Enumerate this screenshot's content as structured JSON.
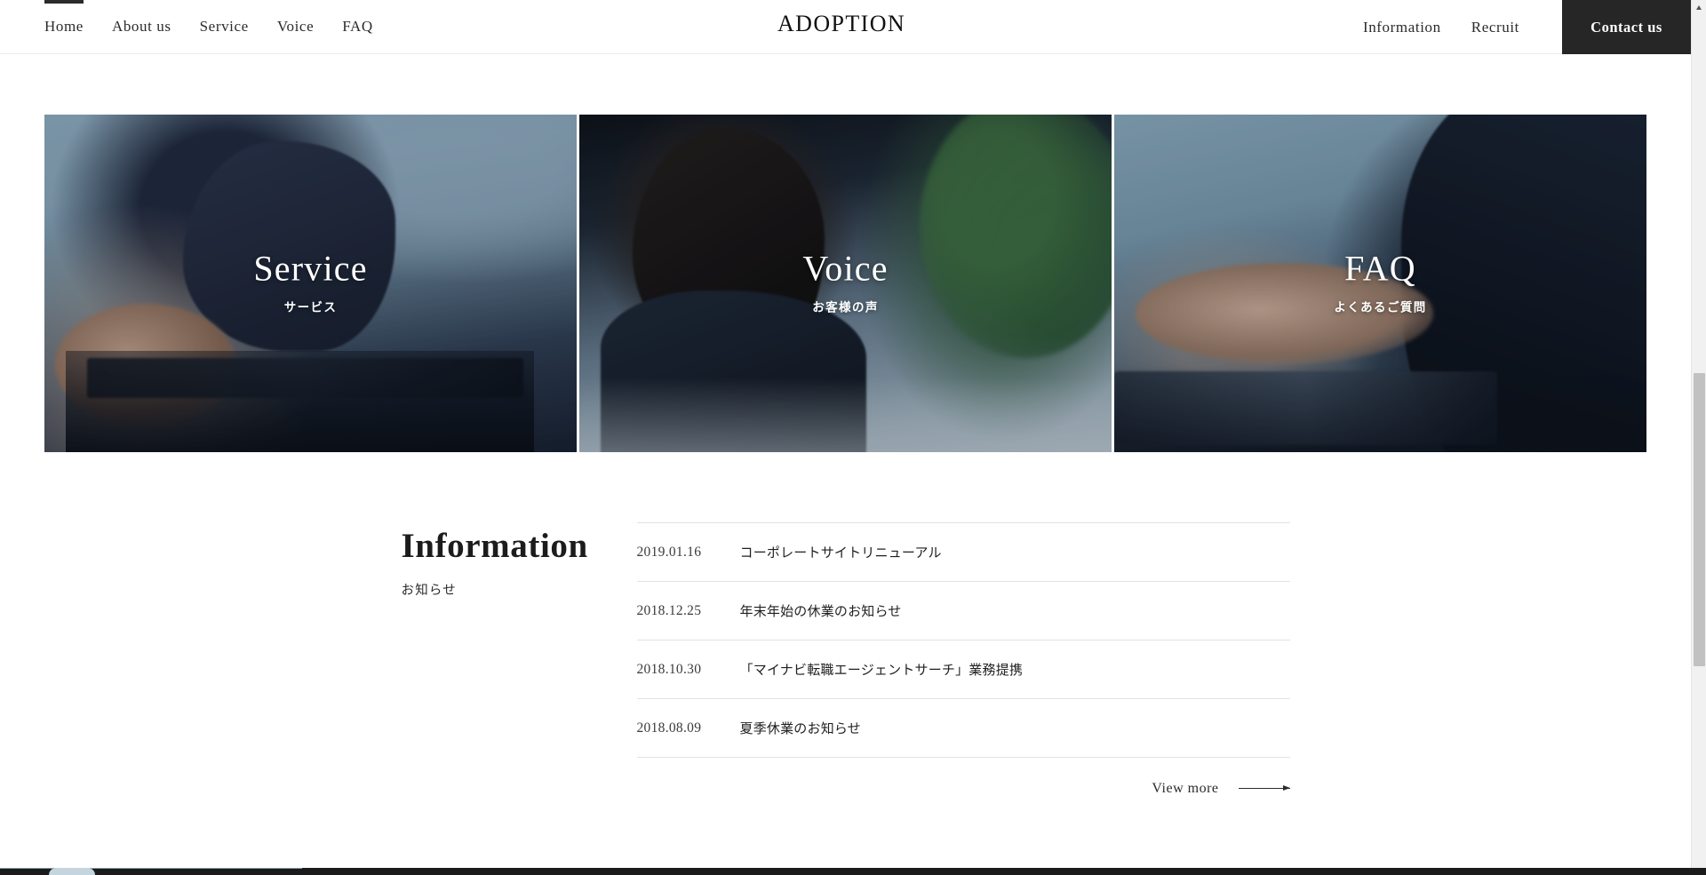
{
  "header": {
    "logo": "ADOPTION",
    "nav_left": [
      {
        "label": "Home",
        "active": true
      },
      {
        "label": "About us",
        "active": false
      },
      {
        "label": "Service",
        "active": false
      },
      {
        "label": "Voice",
        "active": false
      },
      {
        "label": "FAQ",
        "active": false
      }
    ],
    "nav_right": [
      {
        "label": "Information"
      },
      {
        "label": "Recruit"
      }
    ],
    "contact_button": "Contact us",
    "contact_bg": "#262626"
  },
  "tiles": [
    {
      "title": "Service",
      "subtitle": "サービス"
    },
    {
      "title": "Voice",
      "subtitle": "お客様の声"
    },
    {
      "title": "FAQ",
      "subtitle": "よくあるご質問"
    }
  ],
  "information": {
    "title": "Information",
    "subtitle": "お知らせ",
    "news": [
      {
        "date": "2019.01.16",
        "text": "コーポレートサイトリニューアル"
      },
      {
        "date": "2018.12.25",
        "text": "年末年始の休業のお知らせ"
      },
      {
        "date": "2018.10.30",
        "text": "「マイナビ転職エージェントサーチ」業務提携"
      },
      {
        "date": "2018.08.09",
        "text": "夏季休業のお知らせ"
      }
    ],
    "view_more": "View more"
  }
}
